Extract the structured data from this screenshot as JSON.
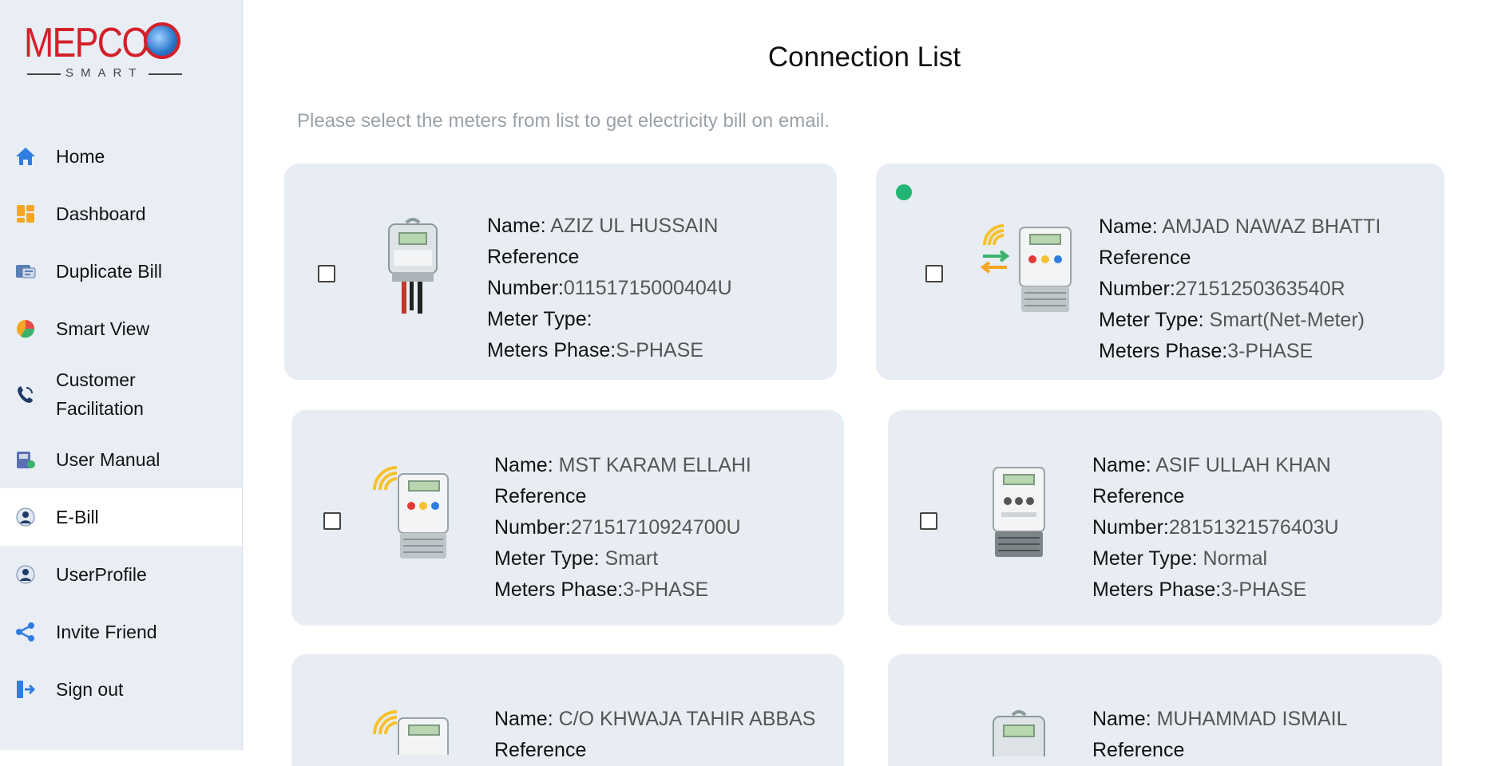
{
  "brand": {
    "logo_text": "MEPCO",
    "logo_sub": "SMART"
  },
  "sidebar": {
    "items": [
      {
        "label": "Home",
        "icon": "home-icon"
      },
      {
        "label": "Dashboard",
        "icon": "dashboard-icon"
      },
      {
        "label": "Duplicate Bill",
        "icon": "bill-icon"
      },
      {
        "label": "Smart View",
        "icon": "pie-chart-icon"
      },
      {
        "label": "Customer Facilitation",
        "icon": "phone-support-icon"
      },
      {
        "label": "User Manual",
        "icon": "manual-icon"
      },
      {
        "label": "E-Bill",
        "icon": "user-icon",
        "active": true
      },
      {
        "label": "UserProfile",
        "icon": "user-icon"
      },
      {
        "label": "Invite Friend",
        "icon": "share-icon"
      },
      {
        "label": "Sign out",
        "icon": "sign-out-icon"
      }
    ]
  },
  "main": {
    "title": "Connection List",
    "hint": "Please select the meters from list to get electricity bill on email."
  },
  "labels": {
    "name": "Name",
    "reference": "Reference",
    "number": "Number",
    "meter_type": "Meter Type",
    "meters_phase": "Meters Phase"
  },
  "connections": [
    {
      "name": "AZIZ UL HUSSAIN",
      "reference": "01151715000404U",
      "meter_type": "",
      "phase": "S-PHASE",
      "meter_icon": "single-phase-meter-icon"
    },
    {
      "name": "AMJAD NAWAZ BHATTI",
      "reference": "27151250363540R",
      "meter_type": "Smart(Net-Meter)",
      "phase": "3-PHASE",
      "meter_icon": "net-smart-meter-icon",
      "online": true
    },
    {
      "name": "MST KARAM ELLAHI",
      "reference": "27151710924700U",
      "meter_type": "Smart",
      "phase": "3-PHASE",
      "meter_icon": "smart-meter-icon"
    },
    {
      "name": "ASIF ULLAH KHAN",
      "reference": "28151321576403U",
      "meter_type": "Normal",
      "phase": "3-PHASE",
      "meter_icon": "three-phase-meter-icon"
    },
    {
      "name": "C/O KHWAJA TAHIR ABBAS",
      "reference": "",
      "meter_type": "",
      "phase": "",
      "meter_icon": "smart-meter-icon"
    },
    {
      "name": "MUHAMMAD ISMAIL",
      "reference": "",
      "meter_type": "",
      "phase": "",
      "meter_icon": "single-phase-meter-icon"
    }
  ],
  "colors": {
    "brand_red": "#d4202a",
    "sidebar_bg": "#e9eef5",
    "card_bg": "#e8edf3",
    "online_green": "#22b573",
    "signal_yellow": "#f6c12c"
  }
}
